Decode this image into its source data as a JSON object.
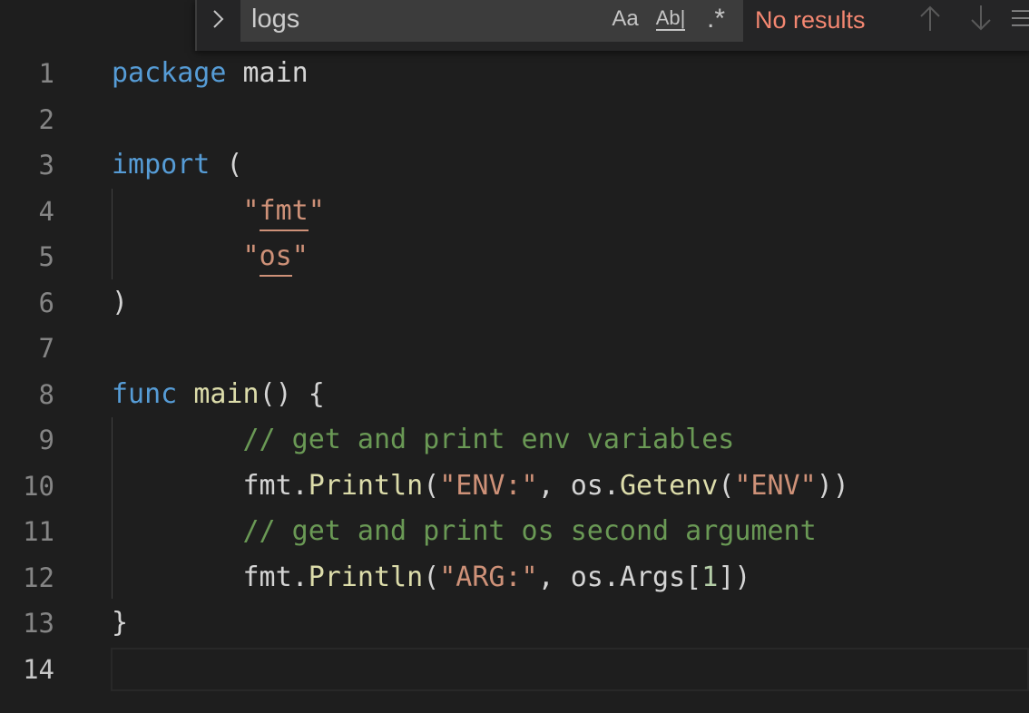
{
  "find_widget": {
    "query": "logs",
    "match_case_label": "Aa",
    "whole_word_label": "Ab|",
    "regex_label": ".*",
    "results_text": "No results",
    "results_color": "#f48771",
    "icons": [
      "chevron-right-icon",
      "arrow-up-icon",
      "arrow-down-icon",
      "selection-lines-icon"
    ]
  },
  "editor": {
    "active_line": "14",
    "colors": {
      "keyword": "#569cd6",
      "function": "#dcdcaa",
      "string": "#ce9178",
      "comment": "#6a9955",
      "number": "#b5cea8",
      "text": "#d4d4d4",
      "background": "#1e1e1e"
    },
    "line_numbers": [
      "1",
      "2",
      "3",
      "4",
      "5",
      "6",
      "7",
      "8",
      "9",
      "10",
      "11",
      "12",
      "13",
      "14"
    ],
    "lines": [
      {
        "tokens": [
          {
            "t": "package",
            "c": "kw"
          },
          {
            "t": " main",
            "c": "plain"
          }
        ]
      },
      {
        "tokens": []
      },
      {
        "tokens": [
          {
            "t": "import",
            "c": "kw"
          },
          {
            "t": " (",
            "c": "plain"
          }
        ]
      },
      {
        "tokens": [
          {
            "t": "        ",
            "c": "plain"
          },
          {
            "t": "\"",
            "c": "str"
          },
          {
            "t": "fmt",
            "c": "str",
            "ul": true
          },
          {
            "t": "\"",
            "c": "str"
          }
        ]
      },
      {
        "tokens": [
          {
            "t": "        ",
            "c": "plain"
          },
          {
            "t": "\"",
            "c": "str"
          },
          {
            "t": "os",
            "c": "str",
            "ul": true
          },
          {
            "t": "\"",
            "c": "str"
          }
        ]
      },
      {
        "tokens": [
          {
            "t": ")",
            "c": "plain"
          }
        ]
      },
      {
        "tokens": []
      },
      {
        "tokens": [
          {
            "t": "func",
            "c": "kw"
          },
          {
            "t": " ",
            "c": "plain"
          },
          {
            "t": "main",
            "c": "fn"
          },
          {
            "t": "() {",
            "c": "plain"
          }
        ]
      },
      {
        "tokens": [
          {
            "t": "        ",
            "c": "plain"
          },
          {
            "t": "// get and print env variables",
            "c": "com"
          }
        ]
      },
      {
        "tokens": [
          {
            "t": "        fmt.",
            "c": "plain"
          },
          {
            "t": "Println",
            "c": "fn"
          },
          {
            "t": "(",
            "c": "plain"
          },
          {
            "t": "\"ENV:\"",
            "c": "str"
          },
          {
            "t": ", os.",
            "c": "plain"
          },
          {
            "t": "Getenv",
            "c": "fn"
          },
          {
            "t": "(",
            "c": "plain"
          },
          {
            "t": "\"ENV\"",
            "c": "str"
          },
          {
            "t": "))",
            "c": "plain"
          }
        ]
      },
      {
        "tokens": [
          {
            "t": "        ",
            "c": "plain"
          },
          {
            "t": "// get and print os second argument",
            "c": "com"
          }
        ]
      },
      {
        "tokens": [
          {
            "t": "        fmt.",
            "c": "plain"
          },
          {
            "t": "Println",
            "c": "fn"
          },
          {
            "t": "(",
            "c": "plain"
          },
          {
            "t": "\"ARG:\"",
            "c": "str"
          },
          {
            "t": ", os.Args[",
            "c": "plain"
          },
          {
            "t": "1",
            "c": "num"
          },
          {
            "t": "])",
            "c": "plain"
          }
        ]
      },
      {
        "tokens": [
          {
            "t": "}",
            "c": "plain"
          }
        ]
      },
      {
        "tokens": []
      }
    ]
  }
}
